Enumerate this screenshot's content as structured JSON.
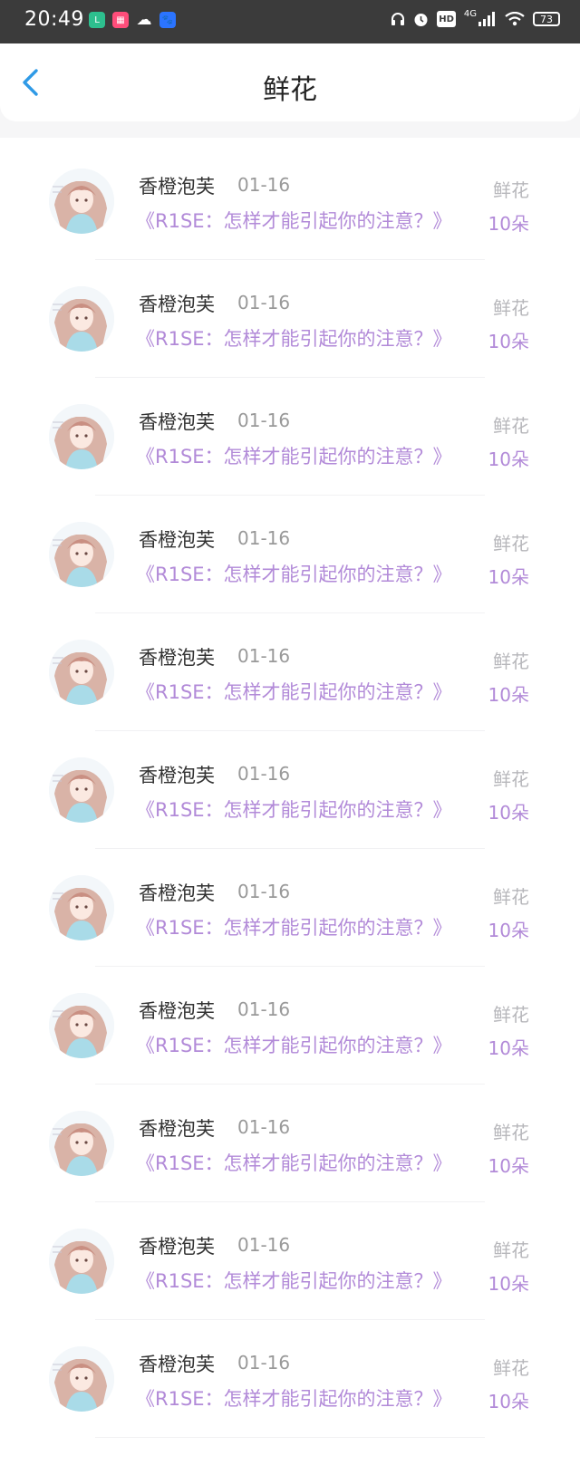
{
  "status_bar": {
    "time": "20:49",
    "network": "4G",
    "battery": "73",
    "hd_label": "HD"
  },
  "header": {
    "title": "鲜花",
    "back_icon": "chevron-left-icon"
  },
  "colors": {
    "accent_blue": "#2f9ae6",
    "purple_text": "#b28ad8",
    "gray_text": "#999999"
  },
  "rows": [
    {
      "name": "香橙泡芙",
      "date": "01-16",
      "song": "《R1SE：怎样才能引起你的注意？》",
      "gift": "鲜花",
      "count": "10朵"
    },
    {
      "name": "香橙泡芙",
      "date": "01-16",
      "song": "《R1SE：怎样才能引起你的注意？》",
      "gift": "鲜花",
      "count": "10朵"
    },
    {
      "name": "香橙泡芙",
      "date": "01-16",
      "song": "《R1SE：怎样才能引起你的注意？》",
      "gift": "鲜花",
      "count": "10朵"
    },
    {
      "name": "香橙泡芙",
      "date": "01-16",
      "song": "《R1SE：怎样才能引起你的注意？》",
      "gift": "鲜花",
      "count": "10朵"
    },
    {
      "name": "香橙泡芙",
      "date": "01-16",
      "song": "《R1SE：怎样才能引起你的注意？》",
      "gift": "鲜花",
      "count": "10朵"
    },
    {
      "name": "香橙泡芙",
      "date": "01-16",
      "song": "《R1SE：怎样才能引起你的注意？》",
      "gift": "鲜花",
      "count": "10朵"
    },
    {
      "name": "香橙泡芙",
      "date": "01-16",
      "song": "《R1SE：怎样才能引起你的注意？》",
      "gift": "鲜花",
      "count": "10朵"
    },
    {
      "name": "香橙泡芙",
      "date": "01-16",
      "song": "《R1SE：怎样才能引起你的注意？》",
      "gift": "鲜花",
      "count": "10朵"
    },
    {
      "name": "香橙泡芙",
      "date": "01-16",
      "song": "《R1SE：怎样才能引起你的注意？》",
      "gift": "鲜花",
      "count": "10朵"
    },
    {
      "name": "香橙泡芙",
      "date": "01-16",
      "song": "《R1SE：怎样才能引起你的注意？》",
      "gift": "鲜花",
      "count": "10朵"
    },
    {
      "name": "香橙泡芙",
      "date": "01-16",
      "song": "《R1SE：怎样才能引起你的注意？》",
      "gift": "鲜花",
      "count": "10朵"
    }
  ]
}
